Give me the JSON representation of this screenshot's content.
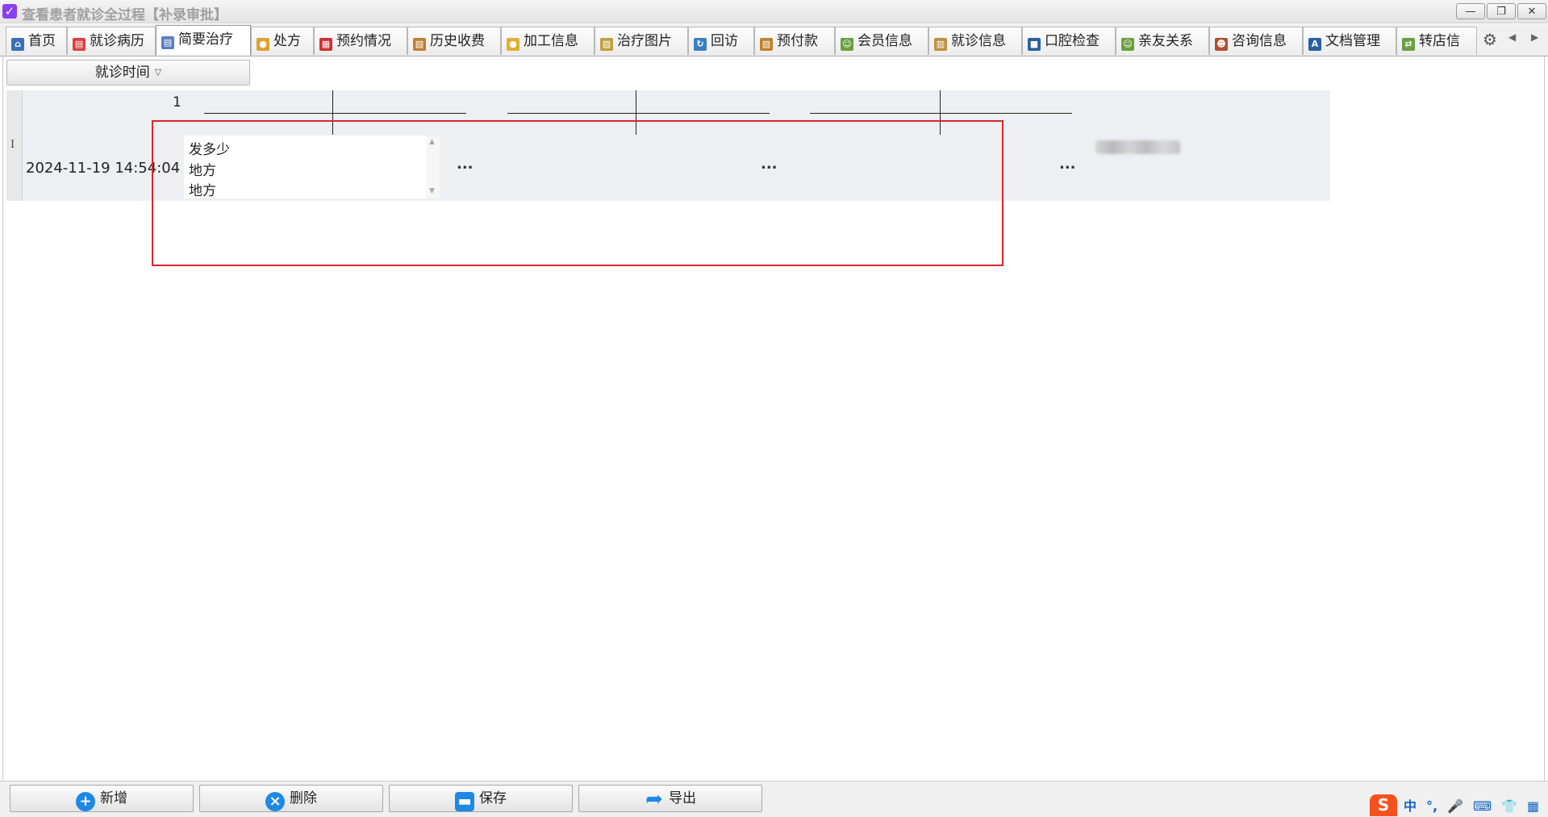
{
  "window": {
    "title": "查看患者就诊全过程【补录审批】",
    "minimize": "—",
    "restore": "❐",
    "close": "✕"
  },
  "tabs": [
    {
      "label": "首页",
      "icon": "home-icon",
      "color": "#3b6fb6"
    },
    {
      "label": "就诊病历",
      "icon": "medical-record-icon",
      "color": "#d84040"
    },
    {
      "label": "简要治疗",
      "icon": "document-icon",
      "color": "#5a7fbf"
    },
    {
      "label": "处方",
      "icon": "pill-icon",
      "color": "#e0a030"
    },
    {
      "label": "预约情况",
      "icon": "calendar-icon",
      "color": "#d03030"
    },
    {
      "label": "历史收费",
      "icon": "billing-icon",
      "color": "#c08030"
    },
    {
      "label": "加工信息",
      "icon": "coins-icon",
      "color": "#e0b030"
    },
    {
      "label": "治疗图片",
      "icon": "image-icon",
      "color": "#c0a040"
    },
    {
      "label": "回访",
      "icon": "refresh-icon",
      "color": "#3a80c0"
    },
    {
      "label": "预付款",
      "icon": "prepay-icon",
      "color": "#c08030"
    },
    {
      "label": "会员信息",
      "icon": "members-icon",
      "color": "#6aa040"
    },
    {
      "label": "就诊信息",
      "icon": "clipboard-icon",
      "color": "#c09040"
    },
    {
      "label": "口腔检查",
      "icon": "briefcase-icon",
      "color": "#2a60a0"
    },
    {
      "label": "亲友关系",
      "icon": "relatives-icon",
      "color": "#6aa040"
    },
    {
      "label": "咨询信息",
      "icon": "consult-icon",
      "color": "#b05030"
    },
    {
      "label": "文档管理",
      "icon": "spell-check-icon",
      "color": "#2a60a0"
    },
    {
      "label": "转店信",
      "icon": "transfer-icon",
      "color": "#6aa040"
    }
  ],
  "active_tab_index": 2,
  "toolbar_misc": {
    "gear": "⚙",
    "scroll_left": "◀",
    "scroll_right": "▶"
  },
  "group_by": {
    "label": "就诊时间",
    "caret": "▽"
  },
  "grid": {
    "column_number": "1",
    "row": {
      "cursor": "I",
      "datetime": "2024-11-19 14:54:04",
      "memo_lines": [
        "发多少",
        "地方",
        "地方"
      ],
      "ellipsis": [
        "...",
        "...",
        "..."
      ]
    }
  },
  "bottom_toolbar": {
    "add": "新增",
    "delete": "删除",
    "save": "保存",
    "export": "导出"
  },
  "ime": {
    "logo": "S",
    "items": [
      "中",
      "°,",
      "🎤",
      "⌨",
      "👕",
      "▦"
    ]
  }
}
